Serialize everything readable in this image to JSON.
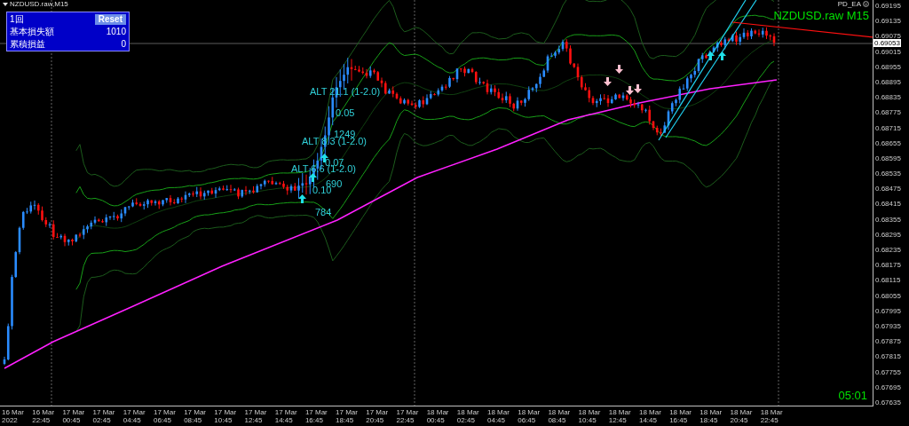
{
  "chart_header": {
    "symbol": "NZDUSD.raw,M15"
  },
  "control_panel": {
    "counter": "1回",
    "reset_button": "Reset",
    "rows": [
      {
        "label": "基本損失額",
        "value": "1010"
      },
      {
        "label": "累積損益",
        "value": "0"
      }
    ]
  },
  "expert_label": "PD_EA",
  "symbol_label": "NZDUSD.raw M15",
  "countdown": "05:01",
  "price_axis": {
    "ticks": [
      "0.69195",
      "0.69135",
      "0.69075",
      "0.69015",
      "0.68955",
      "0.68895",
      "0.68835",
      "0.68775",
      "0.68715",
      "0.68655",
      "0.68595",
      "0.68535",
      "0.68475",
      "0.68415",
      "0.68355",
      "0.68295",
      "0.68235",
      "0.68175",
      "0.68115",
      "0.68055",
      "0.67995",
      "0.67935",
      "0.67875",
      "0.67815",
      "0.67755",
      "0.67695",
      "0.67635"
    ],
    "current_price": "0.69053"
  },
  "time_axis": {
    "ticks": [
      "16 Mar 2022",
      "16 Mar 22:45",
      "17 Mar 00:45",
      "17 Mar 02:45",
      "17 Mar 04:45",
      "17 Mar 06:45",
      "17 Mar 08:45",
      "17 Mar 10:45",
      "17 Mar 12:45",
      "17 Mar 14:45",
      "17 Mar 16:45",
      "17 Mar 18:45",
      "17 Mar 20:45",
      "17 Mar 22:45",
      "18 Mar 00:45",
      "18 Mar 02:45",
      "18 Mar 04:45",
      "18 Mar 06:45",
      "18 Mar 08:45",
      "18 Mar 10:45",
      "18 Mar 12:45",
      "18 Mar 14:45",
      "18 Mar 16:45",
      "18 Mar 18:45",
      "18 Mar 20:45",
      "18 Mar 22:45"
    ]
  },
  "annotations": [
    {
      "text": "ALT 21.1 (1-2.0)"
    },
    {
      "text": "0.05"
    },
    {
      "text": "1249"
    },
    {
      "text": "ALT 8.3 (1-2.0)"
    },
    {
      "text": "0.07"
    },
    {
      "text": "ALT 6.6 (1-2.0)"
    },
    {
      "text": "690"
    },
    {
      "text": "0.10"
    },
    {
      "text": "784"
    }
  ],
  "signals": [
    {
      "kind": "buy"
    },
    {
      "kind": "buy"
    },
    {
      "kind": "buy"
    },
    {
      "kind": "buy"
    },
    {
      "kind": "buy"
    },
    {
      "kind": "sell"
    },
    {
      "kind": "sell"
    },
    {
      "kind": "sell"
    },
    {
      "kind": "sell"
    }
  ]
}
